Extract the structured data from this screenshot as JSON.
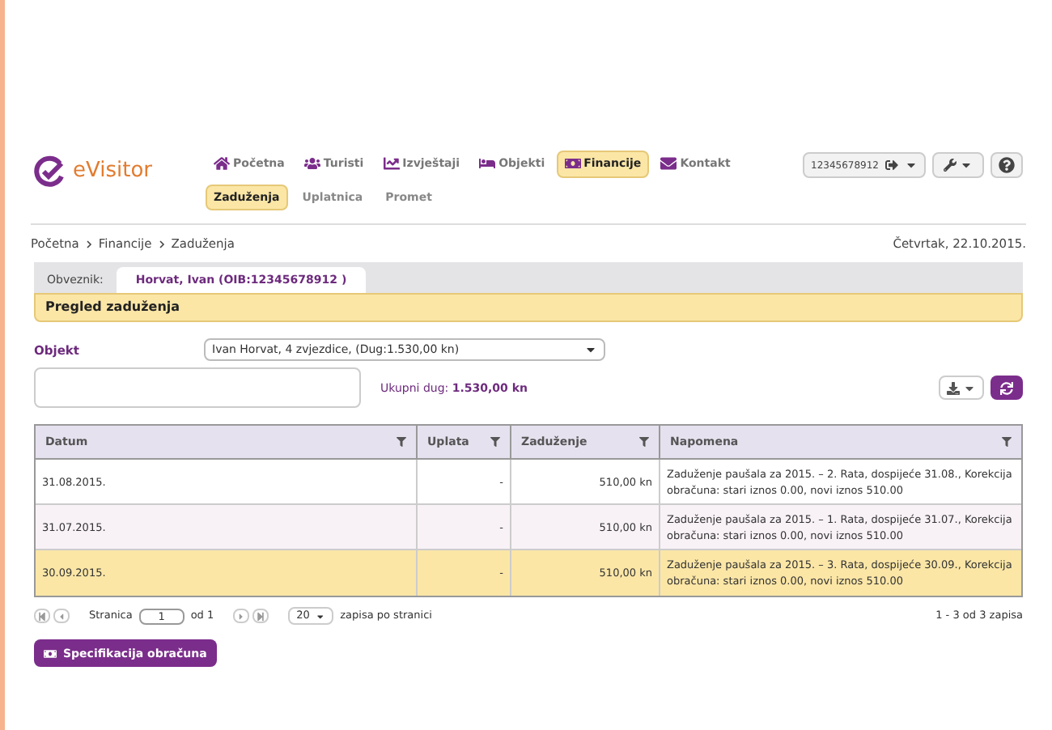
{
  "logo": {
    "text": "eVisitor"
  },
  "nav": [
    {
      "kind": "home",
      "label": "Početna",
      "selected": false
    },
    {
      "kind": "users",
      "label": "Turisti",
      "selected": false
    },
    {
      "kind": "chart",
      "label": "Izvještaji",
      "selected": false
    },
    {
      "kind": "bed",
      "label": "Objekti",
      "selected": false
    },
    {
      "kind": "money",
      "label": "Financije",
      "selected": true
    },
    {
      "kind": "mail",
      "label": "Kontakt",
      "selected": false
    }
  ],
  "subnav": [
    {
      "label": "Zaduženja",
      "selected": true
    },
    {
      "label": "Uplatnica",
      "selected": false
    },
    {
      "label": "Promet",
      "selected": false
    }
  ],
  "user_menu": {
    "label": "12345678912"
  },
  "breadcrumb": [
    "Početna",
    "Financije",
    "Zaduženja"
  ],
  "date": "Četvrtak, 22.10.2015.",
  "obveznik": {
    "label": "Obveznik:",
    "value": "Horvat, Ivan (OIB:12345678912 )"
  },
  "section_title": "Pregled zaduženja",
  "objekt": {
    "label": "Objekt",
    "value": "Ivan Horvat, 4 zvjezdice, (Dug:1.530,00 kn)"
  },
  "total": {
    "label": "Ukupni dug:",
    "value": "1.530,00 kn"
  },
  "table": {
    "columns": [
      "Datum",
      "Uplata",
      "Zaduženje",
      "Napomena"
    ],
    "rows": [
      {
        "selected": false,
        "cells": [
          "31.08.2015.",
          "-",
          "510,00 kn",
          "Zaduženje paušala za 2015. – 2. Rata, dospijeće 31.08., Korekcija obračuna: stari iznos 0.00, novi iznos 510.00"
        ]
      },
      {
        "selected": false,
        "cells": [
          "31.07.2015.",
          "-",
          "510,00 kn",
          "Zaduženje paušala za 2015. – 1. Rata, dospijeće 31.07., Korekcija obračuna: stari iznos 0.00, novi iznos 510.00"
        ]
      },
      {
        "selected": true,
        "cells": [
          "30.09.2015.",
          "-",
          "510,00 kn",
          "Zaduženje paušala za 2015. – 3. Rata, dospijeće 30.09., Korekcija obračuna: stari iznos 0.00, novi iznos 510.00"
        ]
      }
    ]
  },
  "pager": {
    "page_label": "Stranica",
    "page": "1",
    "of_label": "od 1",
    "page_size": "20",
    "size_label": "zapisa po stranici",
    "summary": "1 - 3 od 3 zapisa"
  },
  "action_button": {
    "label": "Specifikacija obračuna"
  }
}
